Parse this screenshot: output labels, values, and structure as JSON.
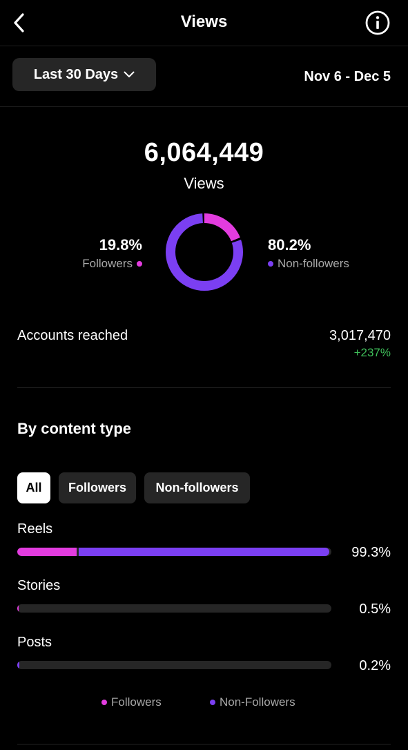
{
  "header": {
    "title": "Views"
  },
  "filters": {
    "range_label": "Last 30 Days",
    "date_range": "Nov 6 - Dec 5"
  },
  "summary": {
    "total_views": "6,064,449",
    "views_label": "Views",
    "followers_pct": "19.8%",
    "followers_label": "Followers",
    "followers_share": 0.198,
    "nonfollowers_pct": "80.2%",
    "nonfollowers_label": "Non-followers"
  },
  "accounts": {
    "label": "Accounts reached",
    "value": "3,017,470",
    "change": "+237%"
  },
  "content_type": {
    "title": "By content type",
    "tabs": [
      {
        "label": "All",
        "active": true
      },
      {
        "label": "Followers",
        "active": false
      },
      {
        "label": "Non-followers",
        "active": false
      }
    ],
    "rows": [
      {
        "label": "Reels",
        "pct": "99.3%",
        "total_share": 0.993,
        "followers_share": 0.19
      },
      {
        "label": "Stories",
        "pct": "0.5%",
        "total_share": 0.005,
        "followers_share": 0.005
      },
      {
        "label": "Posts",
        "pct": "0.2%",
        "total_share": 0.002,
        "followers_share": 0.0
      }
    ],
    "legend": [
      {
        "label": "Followers"
      },
      {
        "label": "Non-Followers"
      }
    ]
  },
  "colors": {
    "followers": "#e33cdf",
    "nonfollowers": "#7b3ff2",
    "positive": "#3fbf5a"
  },
  "icons": {
    "back": "chevron-left-icon",
    "info": "info-icon",
    "dropdown": "chevron-down-icon"
  }
}
